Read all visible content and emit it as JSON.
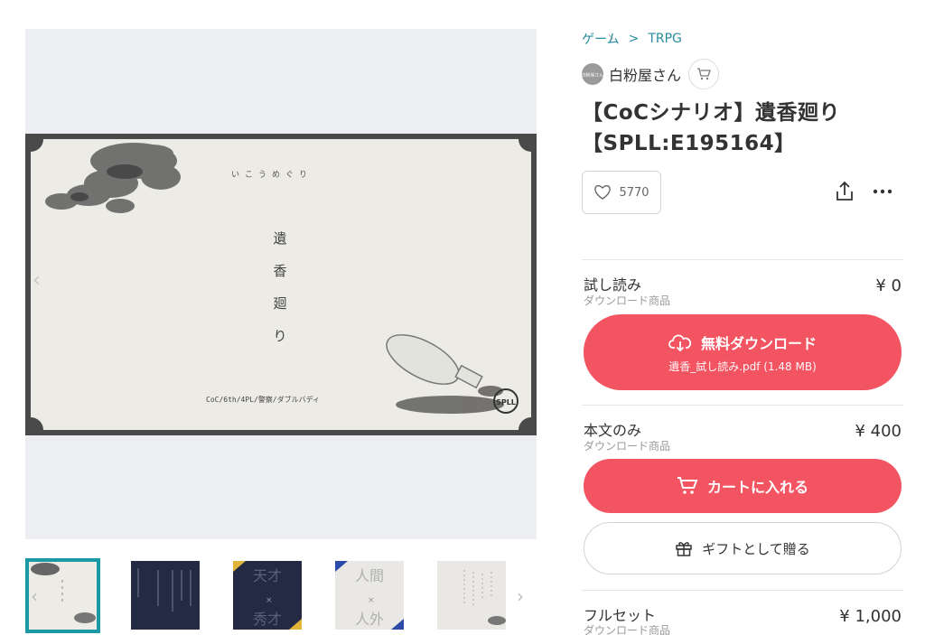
{
  "breadcrumb": {
    "category": "ゲーム",
    "separator": ">",
    "subcategory": "TRPG"
  },
  "shop": {
    "name": "白粉屋さん",
    "avatar_text": "白粉屋さん"
  },
  "product": {
    "title": "【CoCシナリオ】遺香廻り【SPLL:E195164】",
    "likes": "5770"
  },
  "cover": {
    "kana": "いこうめぐり",
    "title_chars": [
      "遺",
      "香",
      "廻",
      "り"
    ],
    "footer": "CoC/6th/4PL/警察/ダブルバディ",
    "badge": "SPLL"
  },
  "gallery": {
    "prev_label": "‹",
    "next_label": "›"
  },
  "thumbs": {
    "t3": {
      "top": "天才",
      "mid": "×",
      "bottom": "秀才"
    },
    "t4": {
      "top": "人間",
      "mid": "×",
      "bottom": "人外"
    }
  },
  "items": [
    {
      "name": "試し読み",
      "sub": "ダウンロード商品",
      "price": "¥ 0",
      "button": "無料ダウンロード",
      "button_sub": "遺香_試し読み.pdf (1.48 MB)"
    },
    {
      "name": "本文のみ",
      "sub": "ダウンロード商品",
      "price": "¥ 400",
      "button": "カートに入れる",
      "gift": "ギフトとして贈る"
    },
    {
      "name": "フルセット",
      "sub": "ダウンロード商品",
      "price": "¥ 1,000"
    }
  ],
  "colors": {
    "accent": "#f25462",
    "link": "#2a8ca0",
    "active_thumb": "#1b9aa6"
  },
  "icons": [
    "chevron-right-icon",
    "cart-icon",
    "heart-icon",
    "share-icon",
    "more-icon",
    "cloud-download-icon",
    "gift-icon"
  ]
}
